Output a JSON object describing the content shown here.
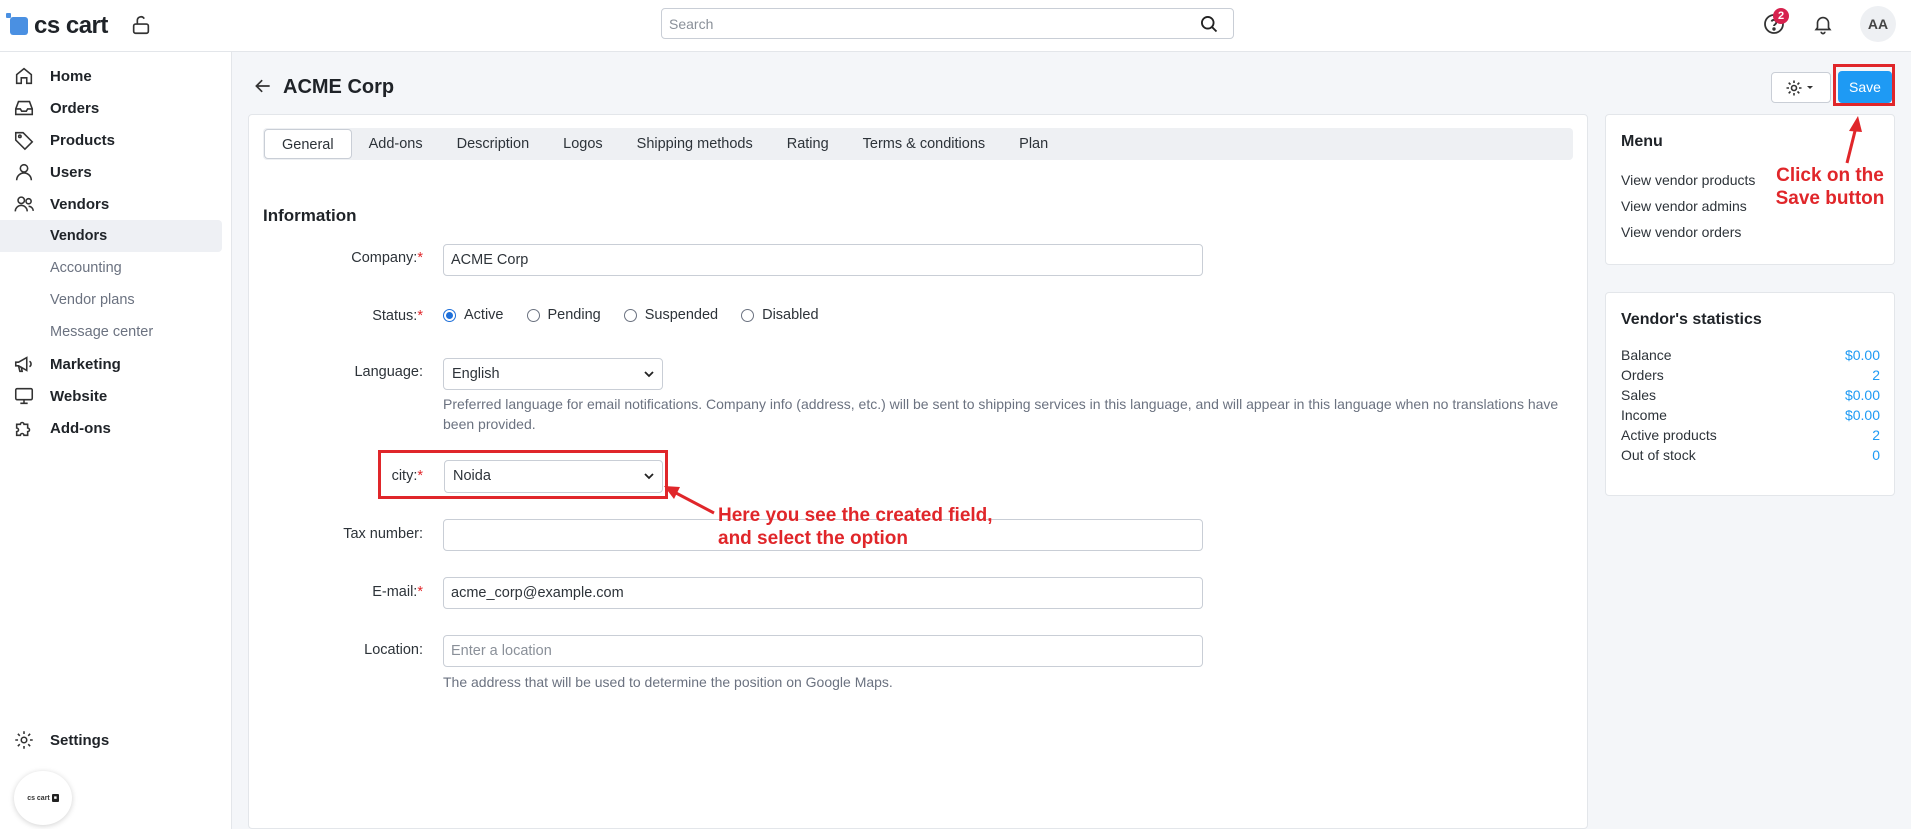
{
  "topbar": {
    "logo_text": "cs cart",
    "search_placeholder": "Search",
    "help_badge": "2",
    "avatar_initials": "AA"
  },
  "sidebar": {
    "items": [
      {
        "label": "Home",
        "icon": "home-icon"
      },
      {
        "label": "Orders",
        "icon": "inbox-icon"
      },
      {
        "label": "Products",
        "icon": "tag-icon"
      },
      {
        "label": "Users",
        "icon": "user-icon"
      },
      {
        "label": "Vendors",
        "icon": "users-icon"
      },
      {
        "label": "Marketing",
        "icon": "megaphone-icon"
      },
      {
        "label": "Website",
        "icon": "monitor-icon"
      },
      {
        "label": "Add-ons",
        "icon": "puzzle-icon"
      }
    ],
    "vendor_subitems": [
      "Vendors",
      "Accounting",
      "Vendor plans",
      "Message center"
    ],
    "settings_label": "Settings",
    "badge_text": "cs cart"
  },
  "header": {
    "title": "ACME Corp",
    "save_label": "Save"
  },
  "tabs": [
    "General",
    "Add-ons",
    "Description",
    "Logos",
    "Shipping methods",
    "Rating",
    "Terms & conditions",
    "Plan"
  ],
  "form": {
    "section_title": "Information",
    "company_label": "Company:",
    "company_value": "ACME Corp",
    "status_label": "Status:",
    "status_options": [
      "Active",
      "Pending",
      "Suspended",
      "Disabled"
    ],
    "status_selected": "Active",
    "language_label": "Language:",
    "language_value": "English",
    "language_hint": "Preferred language for email notifications. Company info (address, etc.) will be sent to shipping services in this language, and will appear in this language when no translations have been provided.",
    "city_label": "city:",
    "city_value": "Noida",
    "tax_label": "Tax number:",
    "tax_value": "",
    "email_label": "E-mail:",
    "email_value": "acme_corp@example.com",
    "location_label": "Location:",
    "location_placeholder": "Enter a location",
    "location_hint": "The address that will be used to determine the position on Google Maps.",
    "required_mark": "*"
  },
  "menu_card": {
    "title": "Menu",
    "links": [
      "View vendor products",
      "View vendor admins",
      "View vendor orders"
    ]
  },
  "stats_card": {
    "title": "Vendor's statistics",
    "rows": [
      {
        "label": "Balance",
        "value": "$0.00"
      },
      {
        "label": "Orders",
        "value": "2"
      },
      {
        "label": "Sales",
        "value": "$0.00"
      },
      {
        "label": "Income",
        "value": "$0.00"
      },
      {
        "label": "Active products",
        "value": "2"
      },
      {
        "label": "Out of stock",
        "value": "0"
      }
    ]
  },
  "annotations": {
    "save_note_line1": "Click on the",
    "save_note_line2": "Save button",
    "field_note_line1": "Here you see the created field,",
    "field_note_line2": "and select the option",
    "color": "#e0262a"
  },
  "colors": {
    "accent": "#1e9af4",
    "annotation_red": "#e0262a"
  }
}
